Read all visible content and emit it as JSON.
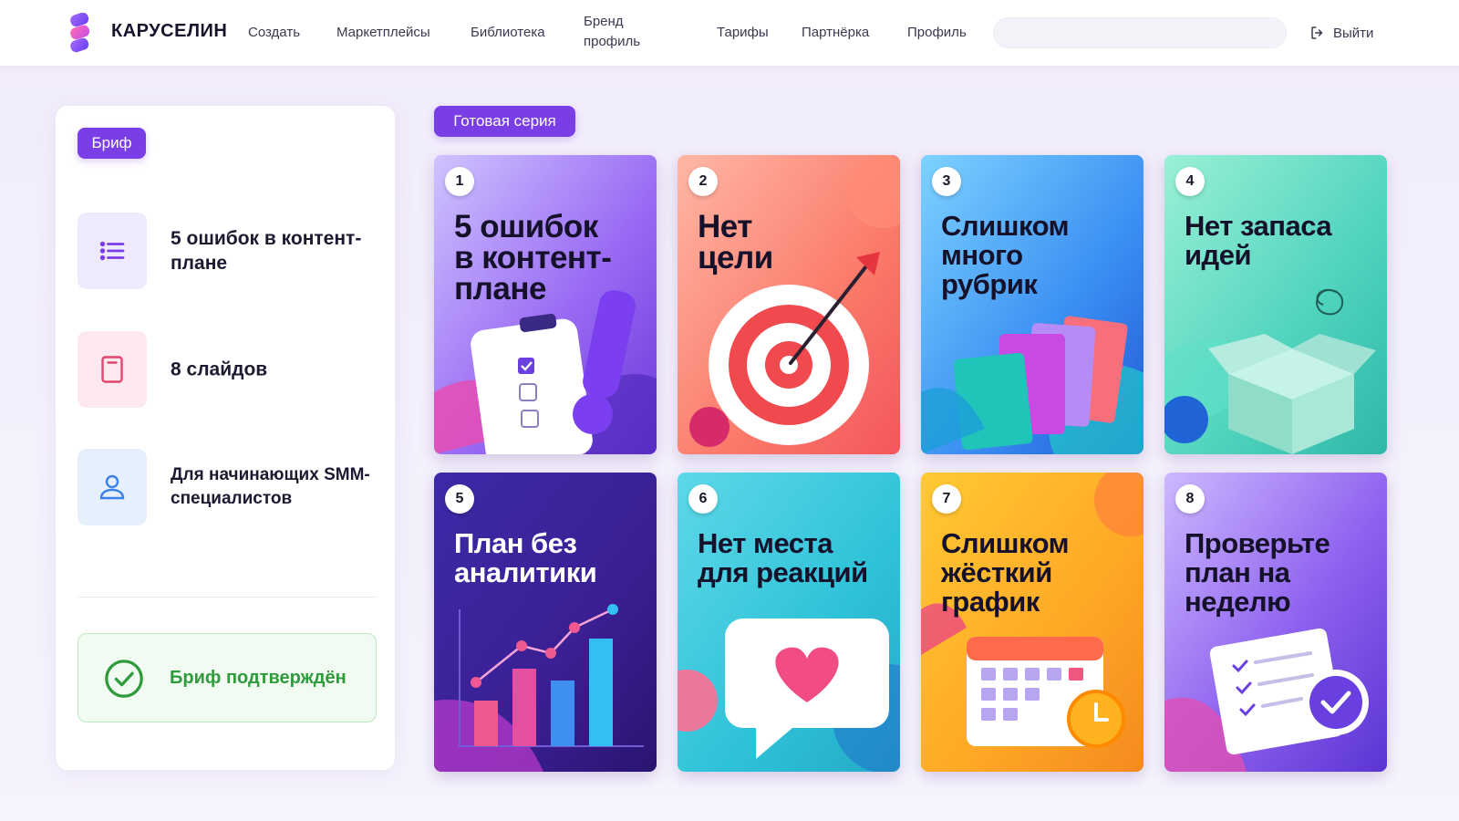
{
  "header": {
    "brand": "КАРУСЕЛИН",
    "nav": [
      {
        "label": "Создать"
      },
      {
        "label": "Маркетплейсы"
      },
      {
        "label": "Библиотека"
      },
      {
        "label": "Бренд профиль"
      },
      {
        "label": "Тарифы"
      },
      {
        "label": "Партнёрка"
      },
      {
        "label": "Профиль"
      }
    ],
    "search": {
      "value": "",
      "placeholder": ""
    },
    "logout": {
      "label": "Выйти",
      "icon": "logout-icon"
    }
  },
  "brief": {
    "badge": "Бриф",
    "items": [
      {
        "text": "5 ошибок в контент-плане",
        "icon": "list-icon"
      },
      {
        "text": "8 слайдов",
        "icon": "slide-icon"
      },
      {
        "text": "Для начинающих SMM-специалистов",
        "icon": "user-icon"
      }
    ],
    "status": {
      "text": "Бриф подтверждён",
      "icon": "check-circle-icon"
    }
  },
  "series": {
    "badge": "Готовая серия",
    "cards": [
      {
        "num": "1",
        "title": "5 ошибок\nв контент-\nплане"
      },
      {
        "num": "2",
        "title": "Нет\nцели"
      },
      {
        "num": "3",
        "title": "Слишком\nмного\nрубрик"
      },
      {
        "num": "4",
        "title": "Нет запаса\nидей"
      },
      {
        "num": "5",
        "title": "План без\nаналитики"
      },
      {
        "num": "6",
        "title": "Нет места\nдля реакций"
      },
      {
        "num": "7",
        "title": "Слишком\nжёсткий\nграфик"
      },
      {
        "num": "8",
        "title": "Проверьте\nплан на\nнеделю"
      }
    ]
  },
  "colors": {
    "accent": "#7a3ee6",
    "success": "#2f9b3d",
    "success_bg": "#f1fbf1"
  }
}
